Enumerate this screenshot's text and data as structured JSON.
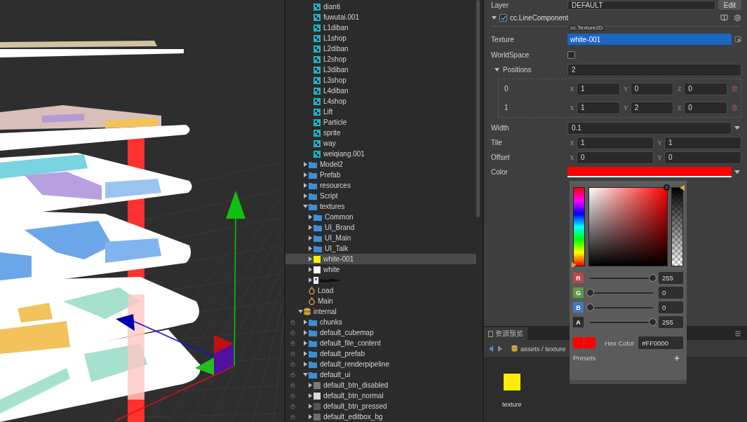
{
  "tree": [
    {
      "children": [
        {
          "children": [
            {
              "label": "dianti",
              "kind": "mesh",
              "selected": false
            },
            {
              "label": "fuwutai.001",
              "kind": "mesh",
              "selected": false
            },
            {
              "label": "L1diban",
              "kind": "mesh",
              "selected": false
            },
            {
              "label": "L1shop",
              "kind": "mesh",
              "selected": false
            },
            {
              "label": "L2diban",
              "kind": "mesh",
              "selected": false
            },
            {
              "label": "L2shop",
              "kind": "mesh",
              "selected": false
            },
            {
              "label": "L3diban",
              "kind": "mesh",
              "selected": false
            },
            {
              "label": "L3shop",
              "kind": "mesh",
              "selected": false
            },
            {
              "label": "L4diban",
              "kind": "mesh",
              "selected": false
            },
            {
              "label": "L4shop",
              "kind": "mesh",
              "selected": false
            },
            {
              "label": "Lift",
              "kind": "mesh",
              "selected": false
            },
            {
              "label": "Particle",
              "kind": "mesh",
              "selected": false
            },
            {
              "label": "sprite",
              "kind": "mesh",
              "selected": false
            },
            {
              "label": "way",
              "kind": "mesh",
              "selected": false
            },
            {
              "label": "weiqiang.001",
              "kind": "mesh",
              "selected": false
            }
          ]
        },
        {
          "label": "Model2",
          "kind": "folder",
          "expanded": false,
          "selected": false
        },
        {
          "label": "Prefab",
          "kind": "folder",
          "expanded": false,
          "selected": false
        },
        {
          "label": "resources",
          "kind": "folder",
          "expanded": false,
          "selected": false
        },
        {
          "label": "Script",
          "kind": "folder",
          "expanded": false,
          "selected": false
        },
        {
          "label": "textures",
          "kind": "folder",
          "expanded": true,
          "selected": false,
          "children": [
            {
              "label": "Common",
              "kind": "folder",
              "expanded": false,
              "selected": false
            },
            {
              "label": "UI_Brand",
              "kind": "folder",
              "expanded": false,
              "selected": false
            },
            {
              "label": "UI_Main",
              "kind": "folder",
              "expanded": false,
              "selected": false
            },
            {
              "label": "UI_Talk",
              "kind": "folder",
              "expanded": false,
              "selected": false
            },
            {
              "label": "white-001",
              "kind": "texture",
              "color": "#ffee00",
              "expanded": false,
              "selected": true
            },
            {
              "label": "white",
              "kind": "texture",
              "color": "#ffffff",
              "expanded": false,
              "selected": false
            },
            {
              "kind": "image",
              "expanded": false,
              "selected": false
            }
          ]
        },
        {
          "label": "Load",
          "kind": "scene",
          "selected": false
        },
        {
          "label": "Main",
          "kind": "scene",
          "selected": false
        }
      ]
    },
    {
      "label": "internal",
      "kind": "database",
      "expanded": true,
      "selected": false,
      "children": [
        {
          "label": "chunks",
          "kind": "folder",
          "locked": true,
          "expanded": false,
          "selected": false
        },
        {
          "label": "default_cubemap",
          "kind": "folder",
          "locked": true,
          "expanded": false,
          "selected": false
        },
        {
          "label": "default_file_content",
          "kind": "folder",
          "locked": true,
          "expanded": false,
          "selected": false
        },
        {
          "label": "default_prefab",
          "kind": "folder",
          "locked": true,
          "expanded": false,
          "selected": false
        },
        {
          "label": "default_renderpipeline",
          "kind": "folder",
          "locked": true,
          "expanded": false,
          "selected": false
        },
        {
          "label": "default_ui",
          "kind": "folder",
          "locked": true,
          "expanded": true,
          "selected": false,
          "children": [
            {
              "label": "default_btn_disabled",
              "kind": "texture",
              "color": "#7a7a7a",
              "locked": true,
              "expanded": false,
              "selected": false
            },
            {
              "label": "default_btn_normal",
              "kind": "texture",
              "color": "#d8d8d8",
              "locked": true,
              "expanded": false,
              "selected": false
            },
            {
              "label": "default_btn_pressed",
              "kind": "texture",
              "color": "#555555",
              "locked": true,
              "expanded": false,
              "selected": false
            },
            {
              "label": "default_editbox_bg",
              "kind": "texture",
              "color": "#6e6e6e",
              "locked": true,
              "expanded": false,
              "selected": false
            }
          ]
        }
      ]
    }
  ],
  "inspector": {
    "layer": {
      "label": "Layer",
      "value": "DEFAULT",
      "button": "Edit"
    },
    "component": {
      "name": "cc.LineComponent",
      "enabled": true,
      "expanded": true
    },
    "texture": {
      "label": "Texture",
      "type": "cc.Texture2D",
      "value": "white-001"
    },
    "world_space": {
      "label": "WorldSpace",
      "checked": false
    },
    "positions": {
      "label": "Positions",
      "expanded": true,
      "count": "2",
      "items": [
        {
          "index": "0",
          "fields": [
            {
              "axis": "X",
              "value": "1"
            },
            {
              "axis": "Y",
              "value": "0"
            },
            {
              "axis": "Z",
              "value": "0"
            }
          ]
        },
        {
          "index": "1",
          "fields": [
            {
              "axis": "X",
              "value": "1"
            },
            {
              "axis": "Y",
              "value": "2"
            },
            {
              "axis": "Z",
              "value": "0"
            }
          ]
        }
      ]
    },
    "width": {
      "label": "Width",
      "value": "0.1"
    },
    "tile": {
      "label": "Tile",
      "fields": [
        {
          "axis": "X",
          "value": "1"
        },
        {
          "axis": "Y",
          "value": "1"
        }
      ]
    },
    "offset": {
      "label": "Offset",
      "fields": [
        {
          "axis": "X",
          "value": "0"
        },
        {
          "axis": "Y",
          "value": "0"
        }
      ]
    },
    "color": {
      "label": "Color",
      "color": "#ff0000"
    }
  },
  "color_picker": {
    "hue": {
      "level": 0
    },
    "saturation": {
      "level": 1
    },
    "brightness": {
      "level": 1
    },
    "alpha_bar": {
      "level": 1
    },
    "channels": [
      {
        "label": "R",
        "color": "#b84a4a",
        "value": "255",
        "level": 1
      },
      {
        "label": "G",
        "color": "#5c9a4a",
        "value": "0",
        "level": 0
      },
      {
        "label": "B",
        "color": "#3d7bc0",
        "value": "0",
        "level": 0
      },
      {
        "label": "A",
        "color": "#2c2c2c",
        "value": "255",
        "level": 1
      }
    ],
    "swatches": [
      {
        "color": "#ff0000"
      },
      {
        "color": "#ff0000"
      }
    ],
    "hex_label": "Hex Color",
    "hex_value": "#FF0000",
    "presets_label": "Presets"
  },
  "preview": {
    "tab": "资源预览",
    "breadcrumb": "assets / texture",
    "items": [
      {
        "label": "texture",
        "color": "#ffee00"
      }
    ]
  }
}
